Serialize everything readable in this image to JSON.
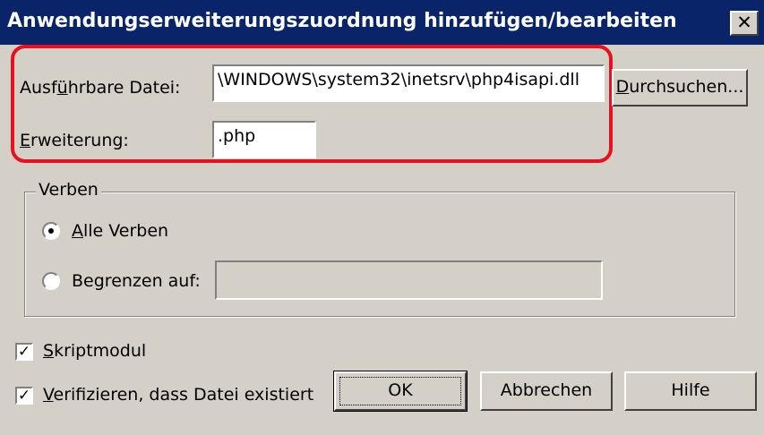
{
  "window": {
    "title": "Anwendungserweiterungszuordnung hinzufügen/bearbeiten",
    "close_glyph": "✕"
  },
  "executable": {
    "label_mnemonic": "Ausf",
    "label_underlined": "ü",
    "label_rest": "hrbare Datei:",
    "value": "\\WINDOWS\\system32\\inetsrv\\php4isapi.dll",
    "browse_underlined": "D",
    "browse_rest": "urchsuchen..."
  },
  "extension": {
    "label_underlined": "E",
    "label_rest": "rweiterung:",
    "value": ".php"
  },
  "verbs": {
    "group_title": "Verben",
    "all_underlined": "A",
    "all_rest": "lle Verben",
    "all_selected": true,
    "limit_pre": "Be",
    "limit_underlined": "g",
    "limit_rest": "renzen auf:",
    "limit_value": ""
  },
  "options": {
    "script_underlined": "S",
    "script_rest": "kriptmodul",
    "script_checked": true,
    "verify_underlined": "V",
    "verify_rest": "erifizieren, dass Datei existiert",
    "verify_checked": true,
    "check_glyph": "✓"
  },
  "buttons": {
    "ok": "OK",
    "cancel": "Abbrechen",
    "help": "Hilfe"
  },
  "colors": {
    "titlebar": "#0a246a",
    "face": "#d4d0c8",
    "highlight": "#e8101e"
  }
}
